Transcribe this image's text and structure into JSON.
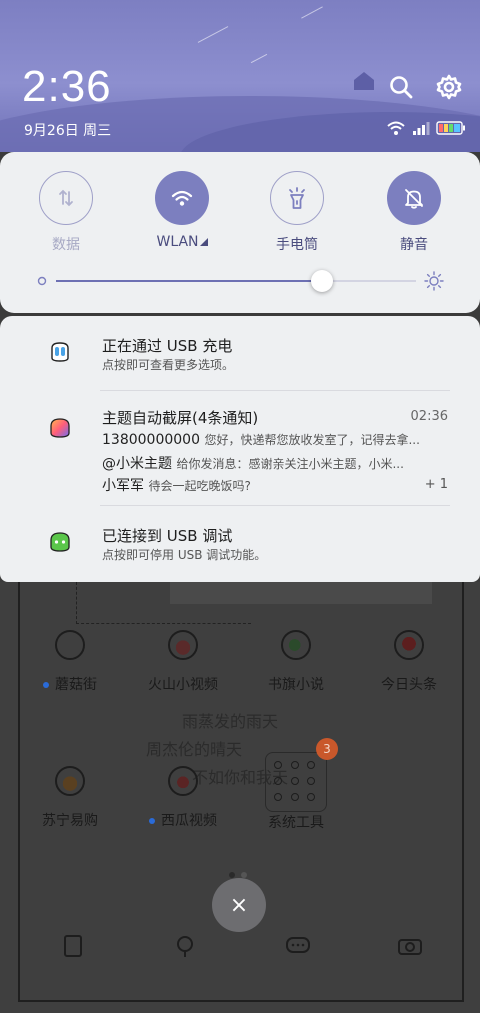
{
  "status": {
    "time": "2:36",
    "date": "9月26日 周三"
  },
  "quick_settings": {
    "toggles": [
      {
        "label": "数据",
        "state": "off",
        "icon": "data-arrows-icon"
      },
      {
        "label": "WLAN",
        "state": "on",
        "icon": "wifi-icon"
      },
      {
        "label": "手电筒",
        "state": "off",
        "icon": "flashlight-icon"
      },
      {
        "label": "静音",
        "state": "on",
        "icon": "bell-off-icon"
      }
    ],
    "brightness_level": 0.74,
    "accent_color": "#7c7fbf"
  },
  "notifications": {
    "usb_charging": {
      "title": "正在通过 USB 充电",
      "subtitle": "点按即可查看更多选项。"
    },
    "theme": {
      "title": "主题自动截屏(4条通知)",
      "time": "02:36",
      "lines": [
        {
          "sender": "13800000000",
          "message": "您好，快递帮您放收发室了，记得去拿..."
        },
        {
          "sender": "@小米主题",
          "message": "给你发消息：感谢亲关注小米主题，小米..."
        },
        {
          "sender": "小军军",
          "message": "待会一起吃晚饭吗?"
        }
      ],
      "more": "+ 1"
    },
    "usb_debug": {
      "title": "已连接到 USB 调试",
      "subtitle": "点按即可停用 USB 调试功能。"
    }
  },
  "home": {
    "apps_row1": [
      "蘑菇街",
      "火山小视频",
      "书旗小说",
      "今日头条"
    ],
    "apps_row2": [
      "苏宁易购",
      "西瓜视频",
      "系统工具"
    ],
    "folder_badge": "3",
    "close_label": "×",
    "sketch_lines": [
      "雨蒸发的雨天",
      "周杰伦的晴天",
      "不如你和我天"
    ]
  }
}
